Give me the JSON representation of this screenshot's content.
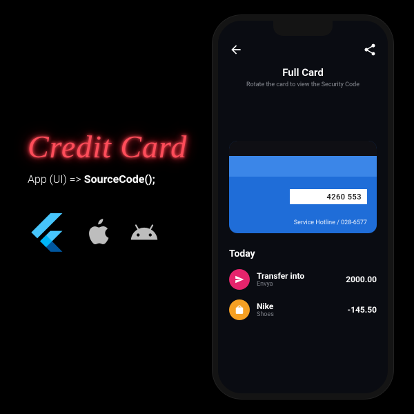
{
  "promo": {
    "neon": "Credit Card",
    "tag_app": "App ",
    "tag_ui": "(UI)",
    "tag_arrow": " => ",
    "tag_src": "SourceCode();"
  },
  "header": {
    "title": "Full Card",
    "subtitle": "Rotate the card to view the Security Code"
  },
  "card": {
    "signature": "4260 553",
    "hotline": "Service Hotline / 028-6577"
  },
  "transactions": {
    "section": "Today",
    "items": [
      {
        "icon_color": "#e6246c",
        "icon": "send",
        "title": "Transfer into",
        "sub": "Envya",
        "amount": "2000.00"
      },
      {
        "icon_color": "#f5a023",
        "icon": "bag",
        "title": "Nike",
        "sub": "Shoes",
        "amount": "-145.50"
      }
    ]
  }
}
